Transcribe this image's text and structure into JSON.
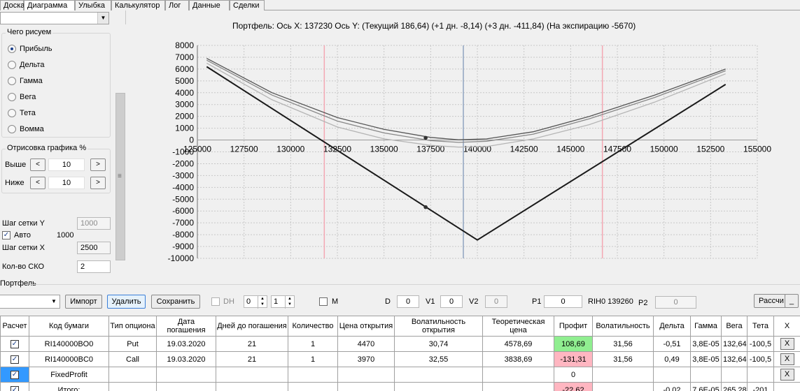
{
  "tabs": [
    {
      "label": "Доска",
      "active": false
    },
    {
      "label": "Диаграмма",
      "active": true
    },
    {
      "label": "Улыбка",
      "active": false
    },
    {
      "label": "Калькулятор",
      "active": false
    },
    {
      "label": "Лог",
      "active": false
    },
    {
      "label": "Данные",
      "active": false
    },
    {
      "label": "Сделки",
      "active": false
    }
  ],
  "left_panel": {
    "what_group_title": "Чего рисуем",
    "radios": [
      {
        "label": "Прибыль",
        "checked": true
      },
      {
        "label": "Дельта",
        "checked": false
      },
      {
        "label": "Гамма",
        "checked": false
      },
      {
        "label": "Вега",
        "checked": false
      },
      {
        "label": "Тета",
        "checked": false
      },
      {
        "label": "Вомма",
        "checked": false
      }
    ],
    "draw_group_title": "Отрисовка графика %",
    "above_label": "Выше",
    "above_value": "10",
    "below_label": "Ниже",
    "below_value": "10",
    "prev_glyph": "<",
    "next_glyph": ">",
    "grid_y_label": "Шаг сетки Y",
    "grid_y_value": "1000",
    "auto_label": "Авто",
    "auto_value": "1000",
    "auto_checked": true,
    "grid_x_label": "Шаг сетки X",
    "grid_x_value": "2500",
    "sko_label": "Кол-во СКО",
    "sko_value": "2"
  },
  "chart": {
    "title": "Портфель:  Ось X: 137230 Ось Y:   (Текущий 186,64)  (+1 дн. -8,14)  (+3 дн. -411,84)  (На экспирацию -5670)"
  },
  "chart_data": {
    "type": "line",
    "title": "Портфель:  Ось X: 137230 Ось Y:   (Текущий 186,64)  (+1 дн. -8,14)  (+3 дн. -411,84)  (На экспирацию -5670)",
    "xlim": [
      125000,
      155000
    ],
    "ylim": [
      -10000,
      8000
    ],
    "x_ticks": [
      125000,
      127500,
      130000,
      132500,
      135000,
      137500,
      140000,
      142500,
      145000,
      147500,
      150000,
      152500,
      155000
    ],
    "y_ticks": [
      8000,
      7000,
      6000,
      5000,
      4000,
      3000,
      2000,
      1000,
      0,
      -1000,
      -2000,
      -3000,
      -4000,
      -5000,
      -6000,
      -7000,
      -8000,
      -9000,
      -10000
    ],
    "grid": true,
    "vlines": [
      {
        "x": 131800,
        "color": "#f4a7b3"
      },
      {
        "x": 139250,
        "color": "#90a4c0"
      },
      {
        "x": 146700,
        "color": "#f4a7b3"
      }
    ],
    "series": [
      {
        "color": "#1a1a1a",
        "x": [
          125500,
          140000,
          153300
        ],
        "y": [
          6200,
          -8450,
          4700
        ]
      },
      {
        "color": "#555555",
        "x": [
          125500,
          129000,
          132500,
          135000,
          137500,
          139000,
          140500,
          143000,
          146000,
          149500,
          153300
        ],
        "y": [
          6900,
          4000,
          1900,
          900,
          220,
          20,
          100,
          700,
          2000,
          3800,
          6000
        ]
      },
      {
        "color": "#888888",
        "x": [
          125500,
          129000,
          132500,
          135000,
          137500,
          139000,
          140500,
          143000,
          146000,
          149500,
          153300
        ],
        "y": [
          6750,
          3800,
          1600,
          600,
          -50,
          -200,
          -100,
          500,
          1800,
          3600,
          5850
        ]
      },
      {
        "color": "#b5b5b5",
        "x": [
          125500,
          129000,
          132500,
          135000,
          137500,
          139000,
          140500,
          143000,
          146000,
          149500,
          153300
        ],
        "y": [
          6500,
          3400,
          1100,
          100,
          -450,
          -600,
          -550,
          100,
          1300,
          3200,
          5600
        ]
      }
    ],
    "markers": [
      {
        "x": 137230,
        "y": 186.64
      },
      {
        "x": 137230,
        "y": -5670
      }
    ]
  },
  "portfolio": {
    "section_title": "Портфель",
    "import_label": "Импорт",
    "delete_label": "Удалить",
    "save_label": "Сохранить",
    "dh_label": "DH",
    "spin1_value": "0",
    "spin2_value": "1",
    "m_label": "M",
    "d_label": "D",
    "d_value": "0",
    "v1_label": "V1",
    "v1_value": "0",
    "v2_label": "V2",
    "v2_value": "0",
    "p1_label": "P1",
    "p1_value": "0",
    "rih_label": "RIH0 139260",
    "p2_label": "P2",
    "p2_value": "0",
    "calc_label": "Рассчи",
    "min_label": "_"
  },
  "table": {
    "headers": [
      "Расчет",
      "Код бумаги",
      "Тип опциона",
      "Дата погашения",
      "Дней до погашения",
      "Количество",
      "Цена открытия",
      "Волатильность открытия",
      "Теоретическая цена",
      "Профит",
      "Волатильность",
      "Дельта",
      "Гамма",
      "Вега",
      "Тета",
      "X"
    ],
    "rows": [
      {
        "check": true,
        "code": "RI140000BO0",
        "type": "Put",
        "date": "19.03.2020",
        "days": "21",
        "qty": "1",
        "price": "4470",
        "vol_open": "30,74",
        "theo": "4578,69",
        "profit": "108,69",
        "profit_state": "pos",
        "vol": "31,56",
        "delta": "-0,51",
        "gamma": "3,8E-05",
        "vega": "132,64",
        "theta": "-100,5",
        "x": "X"
      },
      {
        "check": true,
        "code": "RI140000BC0",
        "type": "Call",
        "date": "19.03.2020",
        "days": "21",
        "qty": "1",
        "price": "3970",
        "vol_open": "32,55",
        "theo": "3838,69",
        "profit": "-131,31",
        "profit_state": "neg",
        "vol": "31,56",
        "delta": "0,49",
        "gamma": "3,8E-05",
        "vega": "132,64",
        "theta": "-100,5",
        "x": "X"
      },
      {
        "check": true,
        "code": "FixedProfit",
        "type": "",
        "date": "",
        "days": "",
        "qty": "",
        "price": "",
        "vol_open": "",
        "theo": "",
        "profit": "0",
        "profit_state": "",
        "vol": "",
        "delta": "",
        "gamma": "",
        "vega": "",
        "theta": "",
        "x": "X",
        "selected": true
      },
      {
        "check": true,
        "code": "Итого:",
        "type": "",
        "date": "",
        "days": "",
        "qty": "",
        "price": "",
        "vol_open": "",
        "theo": "",
        "profit": "-22,62",
        "profit_state": "neg",
        "vol": "",
        "delta": "-0,02",
        "gamma": "7,6E-05",
        "vega": "265,28",
        "theta": "-201",
        "x": ""
      }
    ]
  }
}
